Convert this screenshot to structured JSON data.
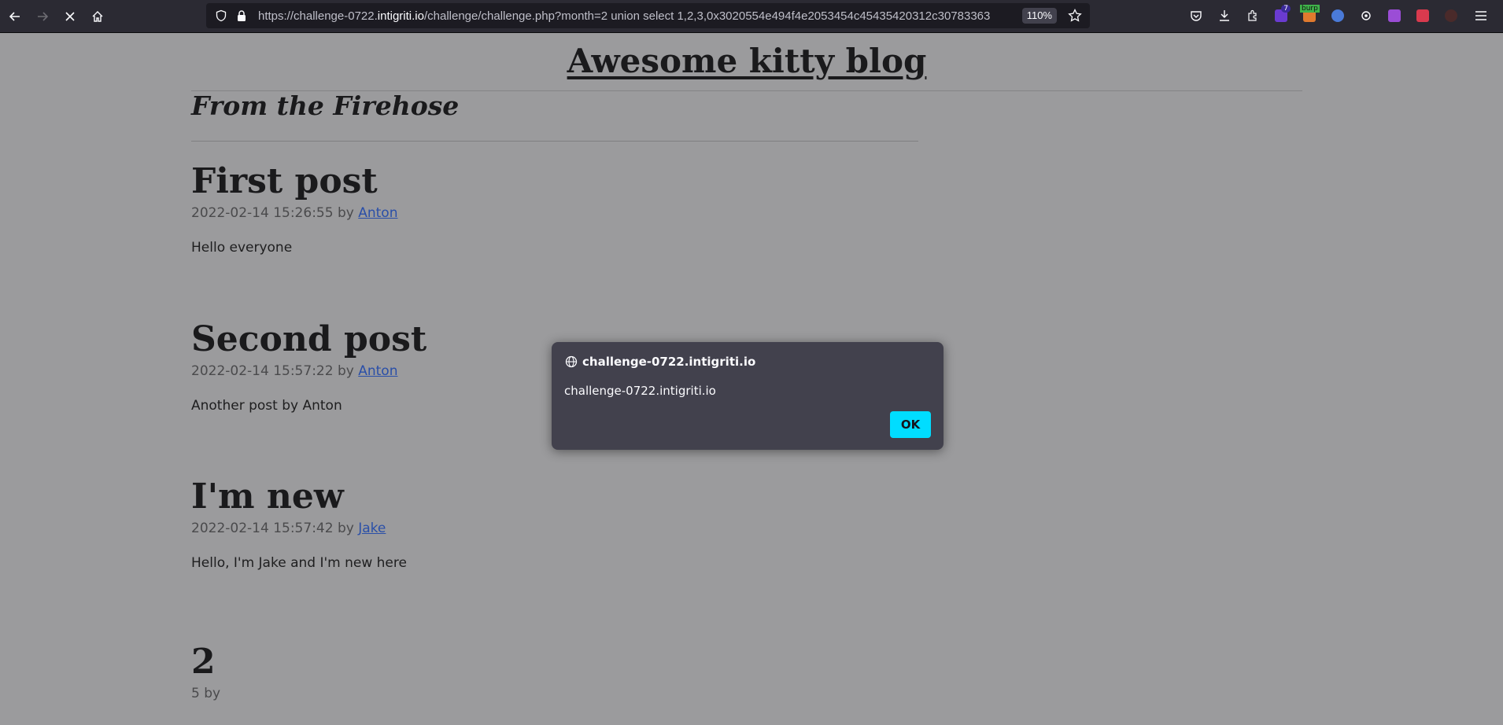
{
  "browser": {
    "url_prefix": "https://challenge-0722.",
    "url_host": "intigriti.io",
    "url_rest": "/challenge/challenge.php?month=2 union select 1,2,3,0x3020554e494f4e2053454c45435420312c30783363",
    "zoom": "110%"
  },
  "page": {
    "site_title": "Awesome kitty blog",
    "section_heading": "From the Firehose",
    "posts": [
      {
        "title": "First post",
        "date": "2022-02-14 15:26:55",
        "by": "by",
        "author": "Anton",
        "body": "Hello everyone"
      },
      {
        "title": "Second post",
        "date": "2022-02-14 15:57:22",
        "by": "by",
        "author": "Anton",
        "body": "Another post by Anton"
      },
      {
        "title": "I'm new",
        "date": "2022-02-14 15:57:42",
        "by": "by",
        "author": "Jake",
        "body": "Hello, I'm Jake and I'm new here"
      },
      {
        "title": "2",
        "date": "5",
        "by": "by",
        "author": "",
        "body": ""
      }
    ]
  },
  "dialog": {
    "origin": "challenge-0722.intigriti.io",
    "message": "challenge-0722.intigriti.io",
    "ok_label": "OK"
  },
  "extensions": {
    "badge_count": "7",
    "burp_label": "burp"
  }
}
